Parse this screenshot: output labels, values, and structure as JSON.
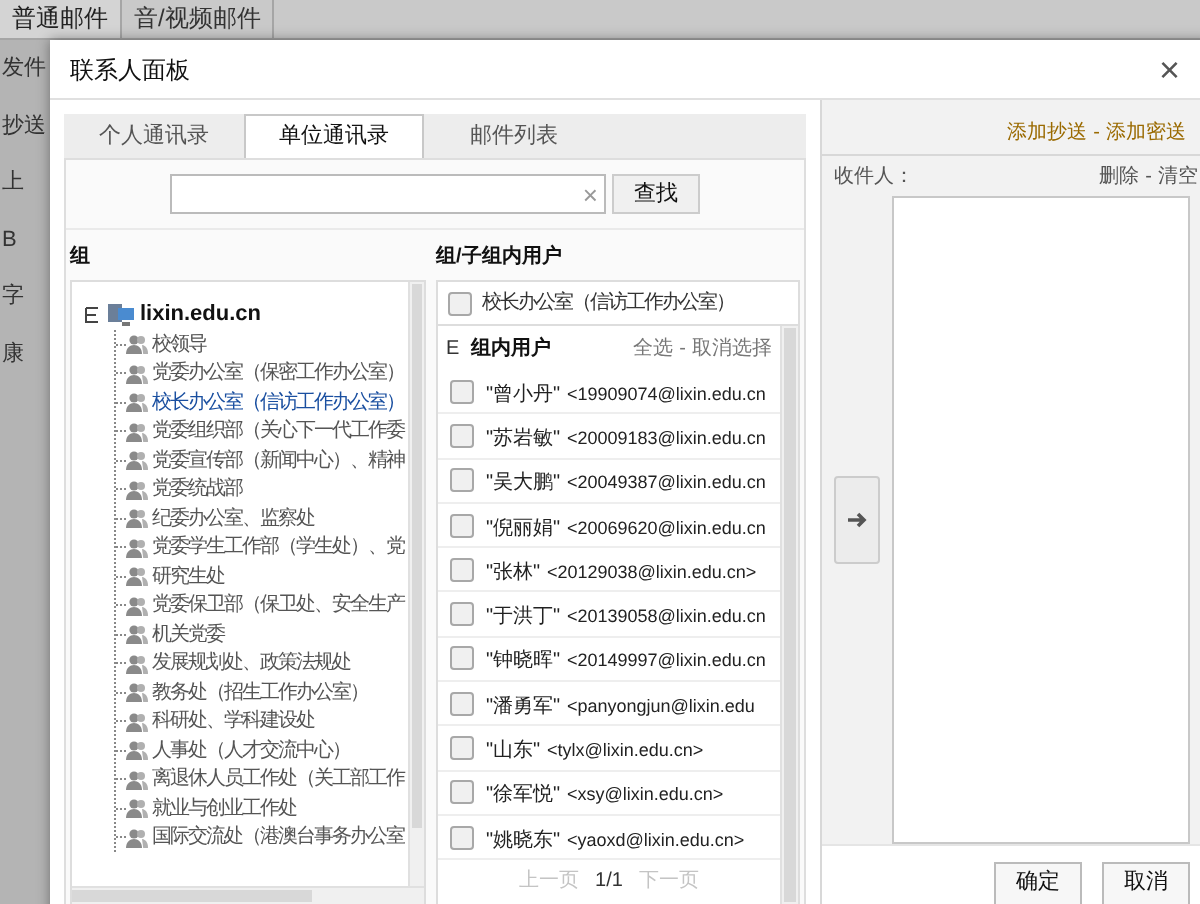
{
  "page_tabs": [
    {
      "label": "普通邮件",
      "selected": true
    },
    {
      "label": "音/视频邮件",
      "selected": false
    }
  ],
  "page_fragments": [
    "发件",
    "抄送",
    "上",
    "B",
    "字",
    "康"
  ],
  "dialog": {
    "title": "联系人面板",
    "close": "×"
  },
  "tabs": [
    {
      "label": "个人通讯录",
      "selected": false
    },
    {
      "label": "单位通讯录",
      "selected": true
    },
    {
      "label": "邮件列表",
      "selected": false
    }
  ],
  "search": {
    "clear": "×",
    "button": "查找"
  },
  "groups": {
    "heading": "组",
    "root": {
      "label": "lixin.edu.cn",
      "expanded": true,
      "children": [
        {
          "label": "校领导",
          "selected": false
        },
        {
          "label": "党委办公室（保密工作办公室）",
          "selected": false
        },
        {
          "label": "校长办公室（信访工作办公室）",
          "selected": true
        },
        {
          "label": "党委组织部（关心下一代工作委",
          "selected": false
        },
        {
          "label": "党委宣传部（新闻中心）、精神",
          "selected": false
        },
        {
          "label": "党委统战部",
          "selected": false
        },
        {
          "label": "纪委办公室、监察处",
          "selected": false
        },
        {
          "label": "党委学生工作部（学生处）、党",
          "selected": false
        },
        {
          "label": "研究生处",
          "selected": false
        },
        {
          "label": "党委保卫部（保卫处、安全生产",
          "selected": false
        },
        {
          "label": "机关党委",
          "selected": false
        },
        {
          "label": "发展规划处、政策法规处",
          "selected": false
        },
        {
          "label": "教务处（招生工作办公室）",
          "selected": false
        },
        {
          "label": "科研处、学科建设处",
          "selected": false
        },
        {
          "label": "人事处（人才交流中心）",
          "selected": false
        },
        {
          "label": "离退休人员工作处（关工部工作",
          "selected": false
        },
        {
          "label": "就业与创业工作处",
          "selected": false
        },
        {
          "label": "国际交流处（港澳台事务办公室",
          "selected": false
        }
      ]
    }
  },
  "members": {
    "heading": "组/子组内用户",
    "group_checkbox": {
      "label": "校长办公室（信访工作办公室）",
      "checked": false
    },
    "list_title": "组内用户",
    "collapse": "E",
    "select_all": "全选",
    "separator": "-",
    "deselect": "取消选择",
    "users": [
      {
        "name": "\"曾小丹\"",
        "email": "<19909074@lixin.edu.cn",
        "checked": false
      },
      {
        "name": "\"苏岩敏\"",
        "email": "<20009183@lixin.edu.cn",
        "checked": false
      },
      {
        "name": "\"吴大鹏\"",
        "email": "<20049387@lixin.edu.cn",
        "checked": false
      },
      {
        "name": "\"倪丽娟\"",
        "email": "<20069620@lixin.edu.cn",
        "checked": false
      },
      {
        "name": "\"张林\"",
        "email": "<20129038@lixin.edu.cn>",
        "checked": false
      },
      {
        "name": "\"于洪丁\"",
        "email": "<20139058@lixin.edu.cn",
        "checked": false
      },
      {
        "name": "\"钟晓晖\"",
        "email": "<20149997@lixin.edu.cn",
        "checked": false
      },
      {
        "name": "\"潘勇军\"",
        "email": "<panyongjun@lixin.edu",
        "checked": false
      },
      {
        "name": "\"山东\"",
        "email": "<tylx@lixin.edu.cn>",
        "checked": false
      },
      {
        "name": "\"徐军悦\"",
        "email": "<xsy@lixin.edu.cn>",
        "checked": false
      },
      {
        "name": "\"姚晓东\"",
        "email": "<yaoxd@lixin.edu.cn>",
        "checked": false
      }
    ],
    "pager": [
      {
        "label": "上一页",
        "disabled": true
      },
      {
        "label": "1/1",
        "disabled": false
      },
      {
        "label": "下一页",
        "disabled": true
      }
    ]
  },
  "recipients": {
    "add_cc": "添加抄送",
    "add_separator": "-",
    "add_bcc": "添加密送",
    "label": "收件人：",
    "delete": "删除",
    "clear_separator": "-",
    "clear": "清空"
  },
  "buttons": [
    "确定",
    "取消"
  ]
}
